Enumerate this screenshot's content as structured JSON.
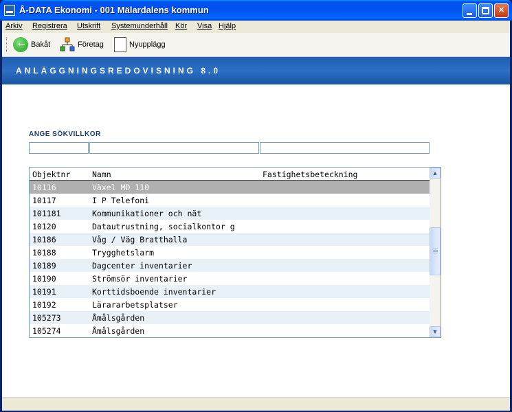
{
  "window": {
    "title": "Å-DATA Ekonomi  -  001 Mälardalens kommun",
    "min_glyph": "",
    "max_glyph": "",
    "close_glyph": "✕"
  },
  "menu": [
    "Arkiv",
    "Registrera",
    "Utskrift",
    "Systemunderhåll",
    "Kör",
    "Visa",
    "Hjälp"
  ],
  "toolbar": {
    "back_label": "Bakåt",
    "company_label": "Företag",
    "new_label": "Nyupplägg"
  },
  "banner": {
    "title": "ANLÄGGNINGSREDOVISNING 8.0"
  },
  "search": {
    "heading": "ANGE SÖKVILLKOR",
    "field1": "",
    "field2": "",
    "field3": ""
  },
  "list": {
    "columns": [
      "Objektnr",
      "Namn",
      "Fastighetsbeteckning"
    ],
    "rows": [
      [
        "10116",
        "Växel MD 110",
        ""
      ],
      [
        "10117",
        "I P Telefoni",
        ""
      ],
      [
        "101181",
        "Kommunikationer och nät",
        ""
      ],
      [
        "10120",
        "Datautrustning, socialkontor g",
        ""
      ],
      [
        "10186",
        "Våg / Väg Bratthalla",
        ""
      ],
      [
        "10188",
        "Trygghetslarm",
        ""
      ],
      [
        "10189",
        "Dagcenter inventarier",
        ""
      ],
      [
        "10190",
        "Strömsör inventarier",
        ""
      ],
      [
        "10191",
        "Korttidsboende inventarier",
        ""
      ],
      [
        "10192",
        "Lärararbetsplatser",
        ""
      ],
      [
        "105273",
        "Åmålsgården",
        ""
      ],
      [
        "105274",
        "Åmålsgården",
        ""
      ]
    ],
    "selected_row": 0
  },
  "icons": {
    "back": "back-arrow-icon",
    "company": "org-chart-icon",
    "new": "document-icon"
  },
  "colors": {
    "banner": "#1f5fb0",
    "selection": "#b0b0b0",
    "alt_row": "#e8f0f8"
  }
}
